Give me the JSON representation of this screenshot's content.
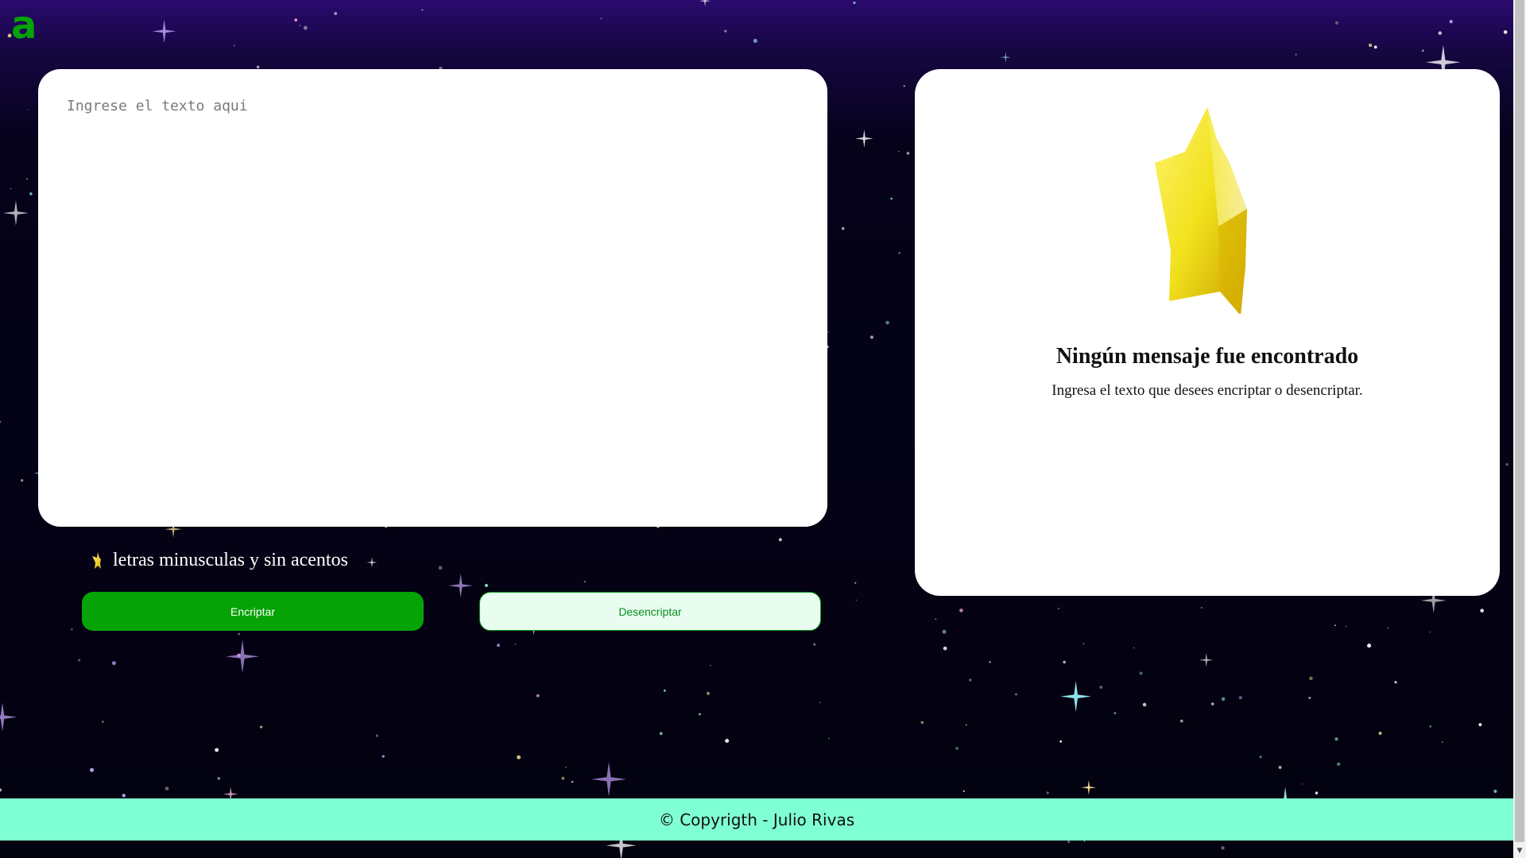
{
  "header": {
    "logo_text": "a",
    "logo_color": "#06a306"
  },
  "input": {
    "placeholder": "Ingrese el texto aqui",
    "value": ""
  },
  "hint": {
    "icon": "star-icon",
    "text": "letras minusculas y sin acentos"
  },
  "buttons": {
    "encrypt_label": "Encriptar",
    "decrypt_label": "Desencriptar"
  },
  "output": {
    "icon": "star-icon",
    "title": "Ningún mensaje fue encontrado",
    "subtitle": "Ingresa el texto que desees encriptar o desencriptar."
  },
  "footer": {
    "text": "© Copyrigth - Julio Rivas",
    "background": "#7fffd4"
  },
  "colors": {
    "accent": "#06a306",
    "decrypt_bg": "#e8fdf0",
    "page_bg_top": "#2a0a6e",
    "page_bg_bottom": "#03020f",
    "star_gold": "#f2e21a"
  }
}
